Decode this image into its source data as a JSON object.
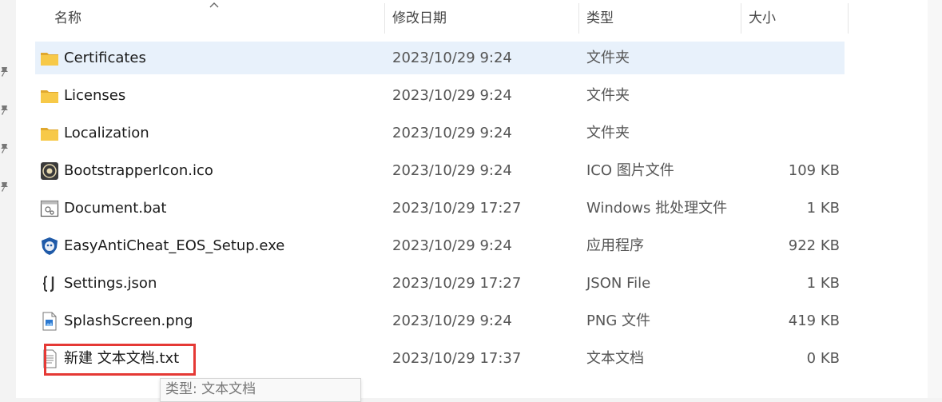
{
  "columns": {
    "name": "名称",
    "date": "修改日期",
    "type": "类型",
    "size": "大小"
  },
  "files": [
    {
      "name": "Certificates",
      "date": "2023/10/29 9:24",
      "type": "文件夹",
      "size": "",
      "icon": "folder-icon",
      "selected": true
    },
    {
      "name": "Licenses",
      "date": "2023/10/29 9:24",
      "type": "文件夹",
      "size": "",
      "icon": "folder-icon"
    },
    {
      "name": "Localization",
      "date": "2023/10/29 9:24",
      "type": "文件夹",
      "size": "",
      "icon": "folder-icon"
    },
    {
      "name": "BootstrapperIcon.ico",
      "date": "2023/10/29 9:24",
      "type": "ICO 图片文件",
      "size": "109 KB",
      "icon": "ico-file-icon"
    },
    {
      "name": "Document.bat",
      "date": "2023/10/29 17:27",
      "type": "Windows 批处理文件",
      "size": "1 KB",
      "icon": "batch-file-icon"
    },
    {
      "name": "EasyAntiCheat_EOS_Setup.exe",
      "date": "2023/10/29 9:24",
      "type": "应用程序",
      "size": "922 KB",
      "icon": "exe-file-icon"
    },
    {
      "name": "Settings.json",
      "date": "2023/10/29 17:27",
      "type": "JSON File",
      "size": "1 KB",
      "icon": "json-file-icon"
    },
    {
      "name": "SplashScreen.png",
      "date": "2023/10/29 9:24",
      "type": "PNG 文件",
      "size": "419 KB",
      "icon": "png-file-icon"
    },
    {
      "name": "新建 文本文档.txt",
      "date": "2023/10/29 17:37",
      "type": "文本文档",
      "size": "0 KB",
      "icon": "txt-file-icon"
    }
  ],
  "tooltip": {
    "text": "类型: 文本文档"
  },
  "colors": {
    "selection": "#e8f1fb",
    "highlight": "#e53935",
    "folder": "#f7c948"
  }
}
